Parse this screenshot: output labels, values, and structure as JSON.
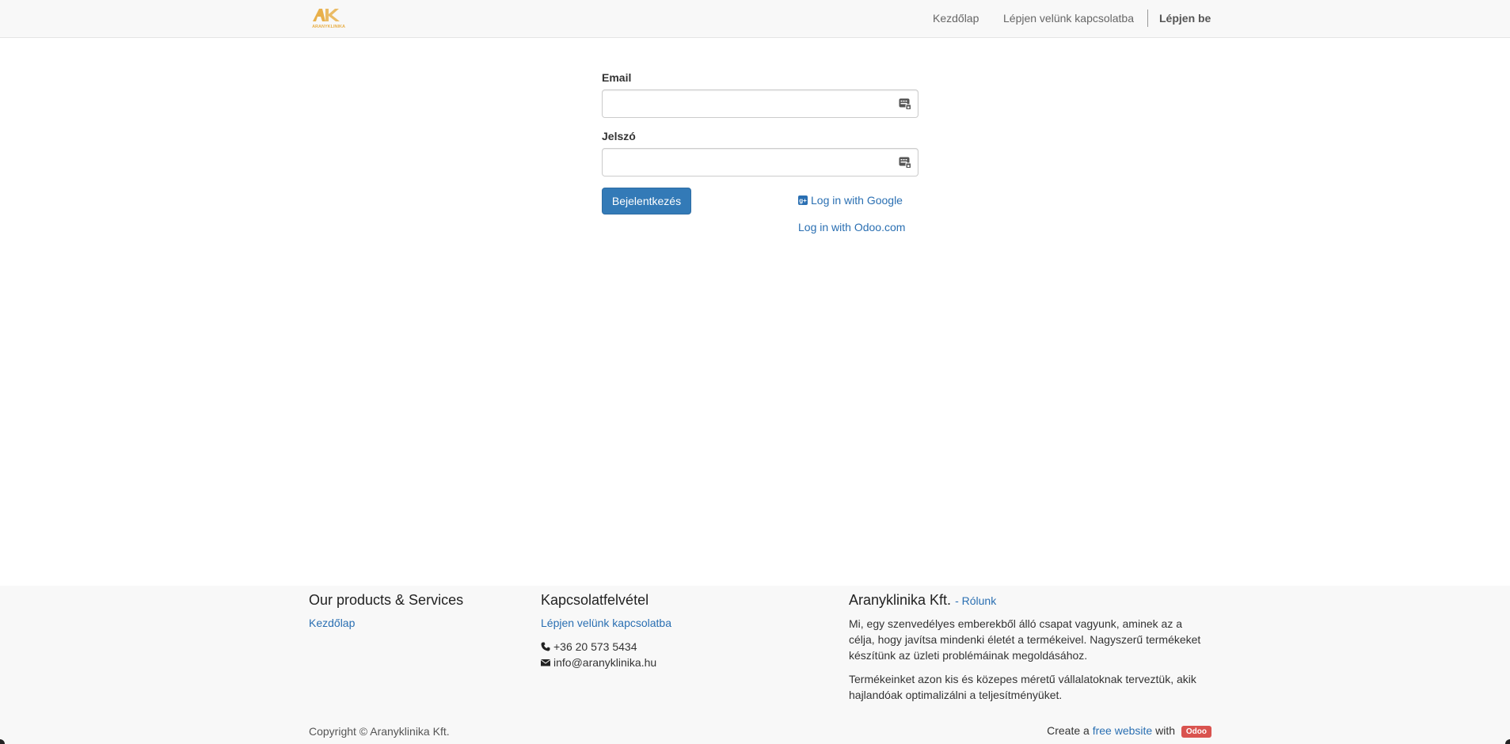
{
  "header": {
    "logo_alt": "Aranyklinika",
    "logo_text": "ARANYKLINIKA",
    "nav": {
      "home": "Kezdőlap",
      "contact": "Lépjen velünk kapcsolatba",
      "signin": "Lépjen be"
    }
  },
  "login": {
    "email_label": "Email",
    "email_value": "",
    "password_label": "Jelszó",
    "password_value": "",
    "submit_label": "Bejelentkezés",
    "google_label": "Log in with Google",
    "odoo_label": "Log in with Odoo.com"
  },
  "footer": {
    "col1": {
      "heading": "Our products & Services",
      "link": "Kezdőlap"
    },
    "col2": {
      "heading": "Kapcsolatfelvétel",
      "link": "Lépjen velünk kapcsolatba",
      "phone": "+36 20 573 5434",
      "email": "info@aranyklinika.hu"
    },
    "col3": {
      "heading": "Aranyklinika Kft.",
      "about_link": "- Rólunk",
      "para1": "Mi, egy szenvedélyes emberekből álló csapat vagyunk, aminek az a célja, hogy javítsa mindenki életét a termékeivel. Nagyszerű termékeket készítünk az üzleti problémáinak megoldásához.",
      "para2": "Termékeinket azon kis és közepes méretű vállalatoknak terveztük, akik hajlandóak optimalizálni a teljesítményüket."
    },
    "copyright": "Copyright © Aranyklinika Kft.",
    "create_prefix": "Create a",
    "create_link": "free website",
    "create_with": "with",
    "odoo_badge": "Odoo"
  },
  "colors": {
    "accent": "#337ab7",
    "link": "#2a6fb2",
    "logo_gold": "#e8b04b",
    "badge": "#d9534f"
  }
}
